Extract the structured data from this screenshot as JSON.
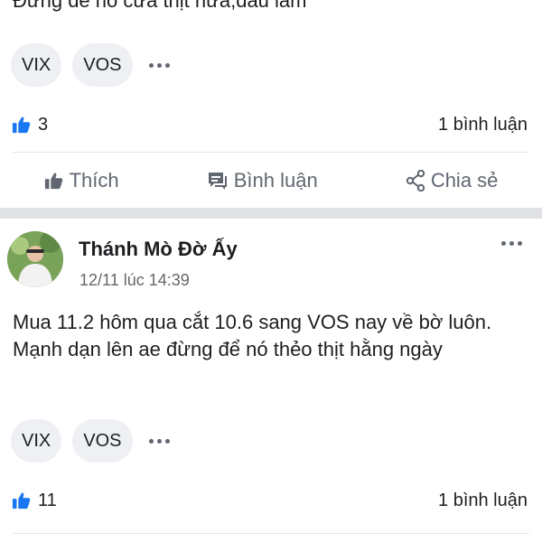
{
  "post1": {
    "text_partial": "Đừng để nó cửa thịt nữa,đau lắm",
    "tags": [
      "VIX",
      "VOS"
    ],
    "likes": "3",
    "comments": "1 bình luận"
  },
  "actions": {
    "like": "Thích",
    "comment": "Bình luận",
    "share": "Chia sẻ"
  },
  "post2": {
    "author": "Thánh Mò Đờ Ấy",
    "time": "12/11 lúc 14:39",
    "text": "Mua 11.2 hôm qua cắt 10.6 sang VOS nay về bờ luôn. Mạnh dạn lên ae đừng để nó thẻo thịt hằng ngày",
    "tags": [
      "VIX",
      "VOS"
    ],
    "likes": "11",
    "comments": "1 bình luận"
  },
  "colors": {
    "accent": "#1877f2",
    "muted": "#65676b",
    "tag_bg": "#eef0f3"
  }
}
